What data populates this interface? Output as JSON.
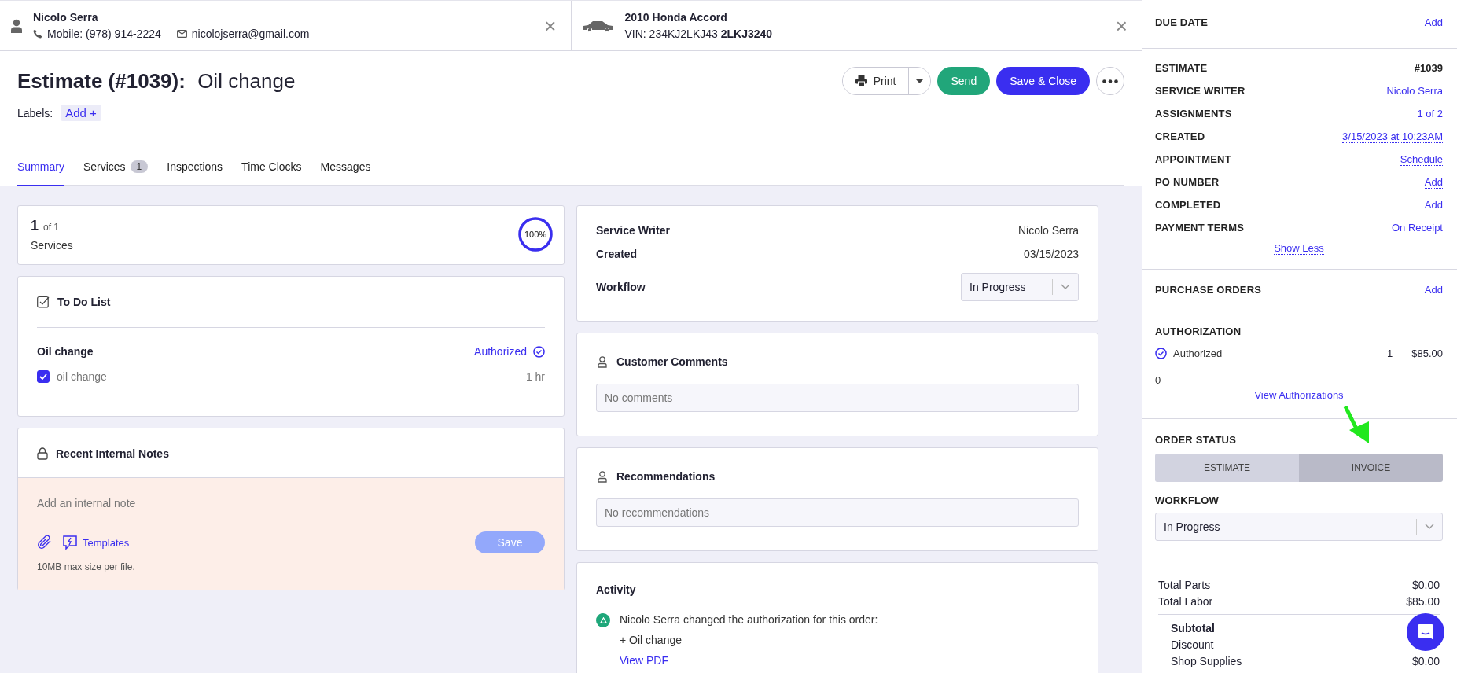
{
  "customer": {
    "name": "Nicolo Serra",
    "phone": "Mobile: (978) 914-2224",
    "email": "nicolojserra@gmail.com",
    "close": "×"
  },
  "vehicle": {
    "name": "2010 Honda Accord",
    "vin": "VIN: 234KJ2LKJ43 **2LKJ3240**",
    "close": "×"
  },
  "header": {
    "title_prefix": "Estimate (#1039):",
    "title": "Oil change",
    "labels_label": "Labels:",
    "labels_add": "Add +"
  },
  "actions": {
    "print": "Print",
    "send": "Send",
    "save_close": "Save & Close"
  },
  "tabs": [
    {
      "label": "Summary",
      "selected": true
    },
    {
      "label": "Services",
      "count": "1",
      "selected": false
    },
    {
      "label": "Inspections",
      "selected": false
    },
    {
      "label": "Time Clocks",
      "selected": false
    },
    {
      "label": "Messages",
      "selected": false
    }
  ],
  "services_card": {
    "count": "1",
    "of": "of 1",
    "label": "Services",
    "percent": "100%",
    "level": 1
  },
  "todo": {
    "title": "To Do List",
    "groups": [
      {
        "name": "Oil change",
        "status": "Authorized",
        "items": [
          {
            "label": "oil change",
            "checked": true,
            "duration": "1 hr"
          }
        ]
      }
    ]
  },
  "notes": {
    "title": "Recent Internal Notes",
    "placeholder": "Add an internal note",
    "templates": "Templates",
    "save": "Save",
    "save_disabled": true,
    "hint": "10MB max size per file."
  },
  "info": [
    {
      "label": "Service Writer",
      "value": "Nicolo Serra",
      "kind": "text"
    },
    {
      "label": "Created",
      "value": "03/15/2023",
      "kind": "text"
    },
    {
      "label": "Workflow",
      "value": "In Progress",
      "kind": "select"
    }
  ],
  "comments": {
    "title": "Customer Comments",
    "placeholder": "No comments"
  },
  "recommendations": {
    "title": "Recommendations",
    "placeholder": "No recommendations"
  },
  "activity": {
    "title": "Activity",
    "entries": [
      {
        "text": "Nicolo Serra changed the authorization for this order:",
        "detail": "+ Oil change",
        "link": "View PDF"
      }
    ]
  },
  "sidebar": {
    "due_date": {
      "label": "DUE DATE",
      "action": "Add"
    },
    "details": [
      {
        "label": "ESTIMATE",
        "value": "#1039",
        "kind": "plain"
      },
      {
        "label": "SERVICE WRITER",
        "value": "Nicolo Serra",
        "kind": "link"
      },
      {
        "label": "ASSIGNMENTS",
        "value": "1 of 2",
        "kind": "link"
      },
      {
        "label": "CREATED",
        "value": "3/15/2023 at 10:23AM",
        "kind": "link"
      },
      {
        "label": "APPOINTMENT",
        "value": "Schedule",
        "kind": "link"
      },
      {
        "label": "PO NUMBER",
        "value": "Add",
        "kind": "link"
      },
      {
        "label": "COMPLETED",
        "value": "Add",
        "kind": "link"
      },
      {
        "label": "PAYMENT TERMS",
        "value": "On Receipt",
        "kind": "link"
      }
    ],
    "show_less": "Show Less",
    "purchase_orders": {
      "label": "PURCHASE ORDERS",
      "action": "Add"
    },
    "authorization": {
      "label": "AUTHORIZATION",
      "status": "Authorized",
      "count": "1",
      "amount": "$85.00",
      "pending": "0",
      "link": "View Authorizations"
    },
    "order_status": {
      "label": "ORDER STATUS",
      "options": [
        {
          "label": "ESTIMATE",
          "selected": false
        },
        {
          "label": "INVOICE",
          "selected": true
        }
      ]
    },
    "workflow": {
      "label": "WORKFLOW",
      "value": "In Progress"
    },
    "totals": [
      {
        "label": "Total Parts",
        "value": "$0.00",
        "kind": "total"
      },
      {
        "label": "Total Labor",
        "value": "$85.00",
        "kind": "total"
      },
      {
        "label": "Subtotal",
        "kind": "subtotal"
      },
      {
        "label": "Discount",
        "kind": "sub"
      },
      {
        "label": "Shop Supplies",
        "value": "$0.00",
        "kind": "sub"
      }
    ]
  }
}
